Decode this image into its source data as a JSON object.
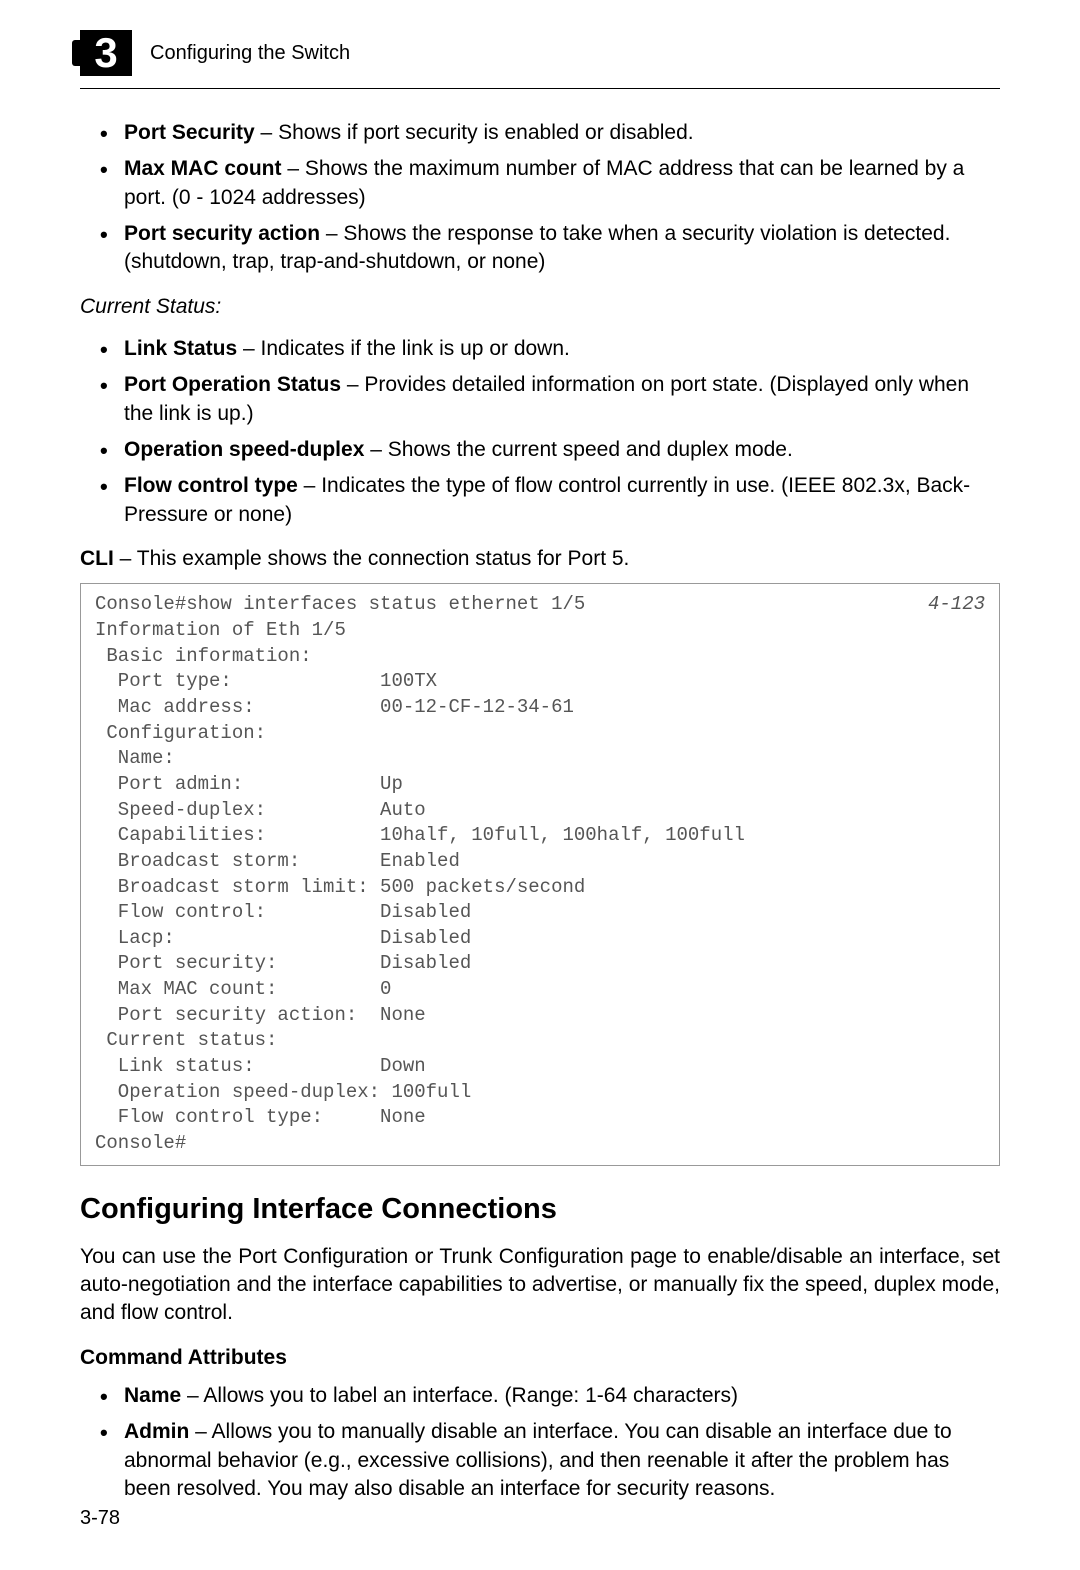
{
  "header": {
    "chapter_num": "3",
    "title": "Configuring the Switch"
  },
  "list1": [
    {
      "term": "Port Security",
      "desc": " – Shows if port security is enabled or disabled."
    },
    {
      "term": "Max MAC count",
      "desc": " – Shows the maximum number of MAC address that can be learned by a port. (0 - 1024 addresses)"
    },
    {
      "term": "Port security action",
      "desc": " – Shows the response to take when a security violation is detected. (shutdown, trap, trap-and-shutdown, or none)"
    }
  ],
  "current_status_label": "Current Status:",
  "list2": [
    {
      "term": "Link Status",
      "desc": " – Indicates if the link is up or down."
    },
    {
      "term": "Port Operation Status",
      "desc": " – Provides detailed information on port state. (Displayed only when the link is up.)"
    },
    {
      "term": "Operation speed-duplex",
      "desc": " – Shows the current speed and duplex mode."
    },
    {
      "term": "Flow control type",
      "desc": " – Indicates the type of flow control currently in use. (IEEE 802.3x, Back-Pressure or none)"
    }
  ],
  "cli_label": "CLI",
  "cli_desc": " – This example shows the connection status for Port 5.",
  "code": {
    "ref": "4-123",
    "body": "Console#show interfaces status ethernet 1/5\nInformation of Eth 1/5\n Basic information:\n  Port type:             100TX\n  Mac address:           00-12-CF-12-34-61\n Configuration:\n  Name:\n  Port admin:            Up\n  Speed-duplex:          Auto\n  Capabilities:          10half, 10full, 100half, 100full\n  Broadcast storm:       Enabled\n  Broadcast storm limit: 500 packets/second\n  Flow control:          Disabled\n  Lacp:                  Disabled\n  Port security:         Disabled\n  Max MAC count:         0\n  Port security action:  None\n Current status:\n  Link status:           Down\n  Operation speed-duplex: 100full\n  Flow control type:     None\nConsole#"
  },
  "section_heading": "Configuring Interface Connections",
  "section_para": "You can use the Port Configuration or Trunk Configuration page to enable/disable an interface, set auto-negotiation and the interface capabilities to advertise, or manually fix the speed, duplex mode, and flow control.",
  "cmd_attr_heading": "Command Attributes",
  "list3": [
    {
      "term": "Name",
      "desc": " – Allows you to label an interface. (Range: 1-64 characters)"
    },
    {
      "term": "Admin",
      "desc": " – Allows you to manually disable an interface. You can disable an interface due to abnormal behavior (e.g., excessive collisions), and then reenable it after the problem has been resolved. You may also disable an interface for security reasons."
    }
  ],
  "page_num": "3-78"
}
